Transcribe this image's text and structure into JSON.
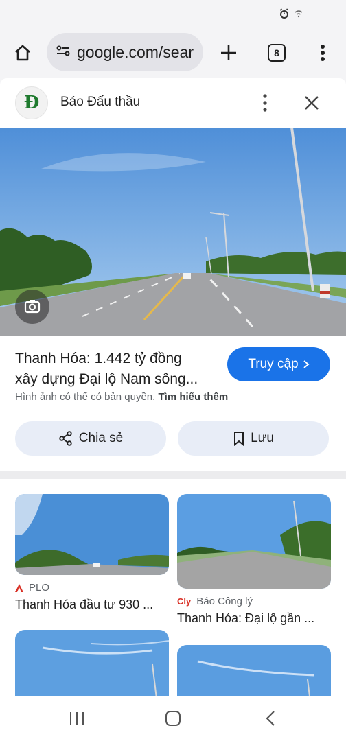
{
  "toolbar": {
    "url": "google.com/sear",
    "tab_count": "8"
  },
  "panel": {
    "site_logo_letter": "Đ",
    "site_name": "Báo Đấu thầu",
    "title_line1": "Thanh Hóa: 1.442 tỷ đồng",
    "title_line2": "xây dựng Đại lộ Nam sông...",
    "visit_label": "Truy cập",
    "copyright_text": "Hình ảnh có thể có bản quyền.",
    "learn_more": "Tìm hiểu thêm",
    "share_label": "Chia sẻ",
    "save_label": "Lưu"
  },
  "related": [
    {
      "source": "PLO",
      "title": "Thanh Hóa đầu tư 930 ..."
    },
    {
      "source": "Báo Công lý",
      "title": "Thanh Hóa: Đại lộ gần ..."
    }
  ],
  "colors": {
    "accent": "#1a73e8",
    "pill_bg": "#e8edf7",
    "plo_red": "#d93025"
  }
}
